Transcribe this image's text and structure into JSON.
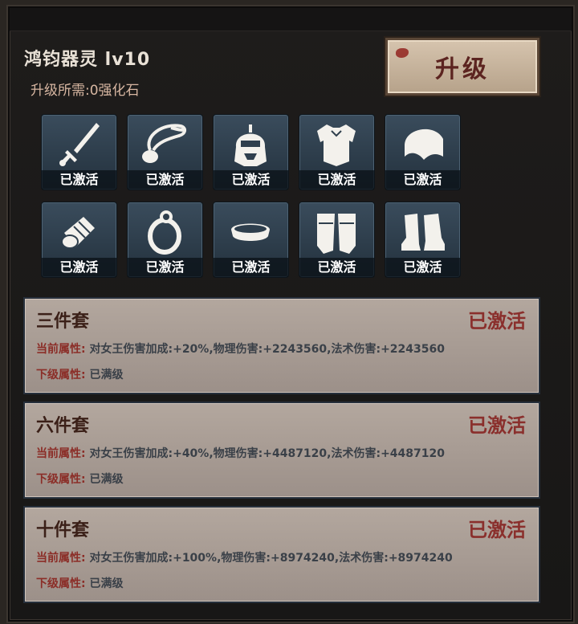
{
  "header": {
    "title": "鸿钧器灵 lv10",
    "cost": "升级所需:0强化石",
    "upgrade_label": "升级"
  },
  "slots": [
    {
      "icon": "sword-icon",
      "label": "已激活"
    },
    {
      "icon": "necklace-icon",
      "label": "已激活"
    },
    {
      "icon": "helmet-icon",
      "label": "已激活"
    },
    {
      "icon": "armor-icon",
      "label": "已激活"
    },
    {
      "icon": "shoulder-icon",
      "label": "已激活"
    },
    {
      "icon": "bracer-icon",
      "label": "已激活"
    },
    {
      "icon": "ring-icon",
      "label": "已激活"
    },
    {
      "icon": "belt-icon",
      "label": "已激活"
    },
    {
      "icon": "leggings-icon",
      "label": "已激活"
    },
    {
      "icon": "boots-icon",
      "label": "已激活"
    }
  ],
  "sets": [
    {
      "name": "三件套",
      "status": "已激活",
      "current_label": "当前属性:",
      "current_value": "对女王伤害加成:+20%,物理伤害:+2243560,法术伤害:+2243560",
      "next_label": "下级属性:",
      "next_value": "已满级"
    },
    {
      "name": "六件套",
      "status": "已激活",
      "current_label": "当前属性:",
      "current_value": "对女王伤害加成:+40%,物理伤害:+4487120,法术伤害:+4487120",
      "next_label": "下级属性:",
      "next_value": "已满级"
    },
    {
      "name": "十件套",
      "status": "已激活",
      "current_label": "当前属性:",
      "current_value": "对女王伤害加成:+100%,物理伤害:+8974240,法术伤害:+8974240",
      "next_label": "下级属性:",
      "next_value": "已满级"
    }
  ],
  "colors": {
    "panel_bg": "#1b1a19",
    "accent_red": "#8a2f2c",
    "slot_bg": "#2f3f4d"
  }
}
